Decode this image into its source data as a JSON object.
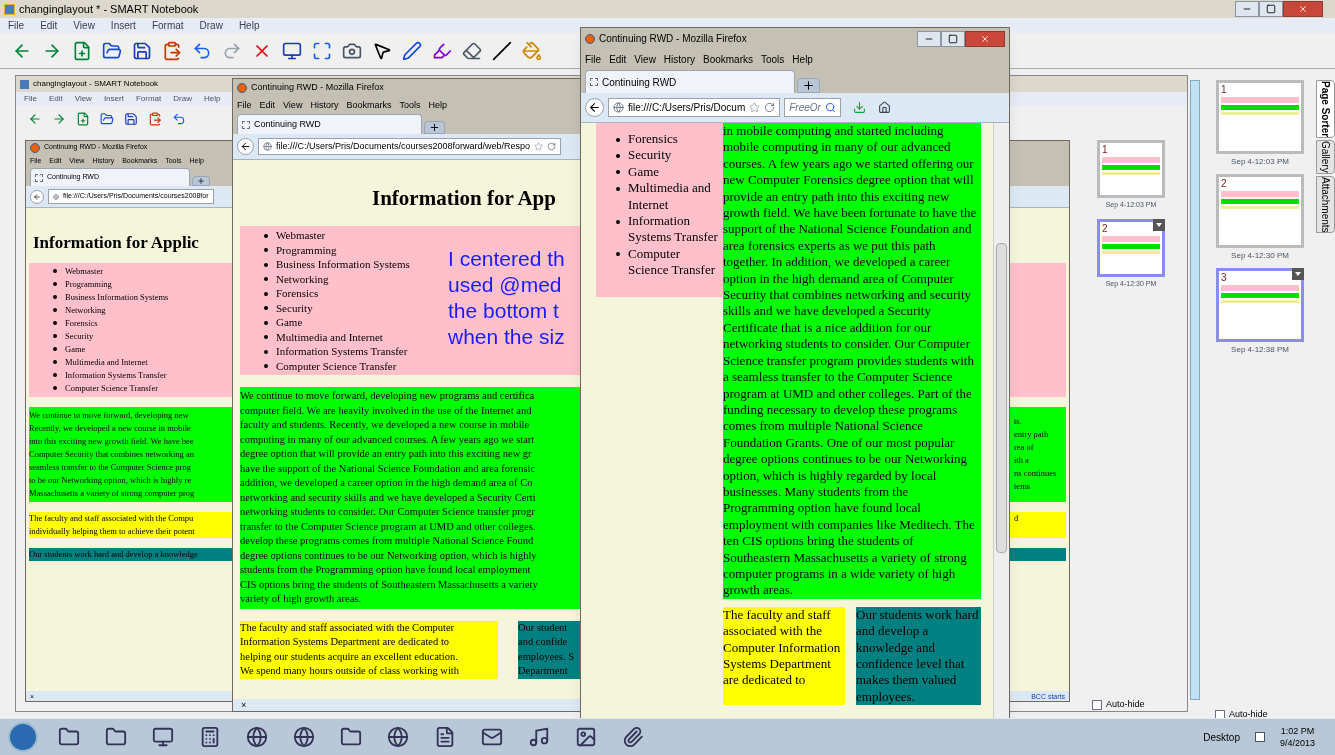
{
  "notebook": {
    "title": "changinglayout * - SMART Notebook",
    "menu": [
      "File",
      "Edit",
      "View",
      "Insert",
      "Format",
      "Draw",
      "Help"
    ]
  },
  "inner_notebook": {
    "title": "changinglayout - SMART Notebook",
    "menu": [
      "File",
      "Edit",
      "View",
      "Insert",
      "Format",
      "Draw",
      "Help"
    ],
    "sorter": {
      "pages": [
        {
          "number": "1",
          "time": "Sep 4-12:03 PM",
          "selected": false
        },
        {
          "number": "2",
          "time": "Sep 4-12:30 PM",
          "selected": true
        }
      ],
      "auto_hide": {
        "label": "Auto-hide",
        "checked": false
      }
    },
    "taskbar_item": "BCC starts"
  },
  "browsers": [
    {
      "kind": "back",
      "title": "Continuing RWD - Mozilla Firefox",
      "menu": [
        "File",
        "Edit",
        "View",
        "History",
        "Bookmarks",
        "Tools",
        "Help"
      ],
      "tab": "Continuing RWD",
      "url": "file:///C:/Users/Pris/Documents/courses2008for",
      "heading": "Information for Applic",
      "list": [
        "Webmaster",
        "Programming",
        "Business Information Systems",
        "Networking",
        "Forensics",
        "Security",
        "Game",
        "Multimedia and Internet",
        "Information Systems Transfer",
        "Computer Science Transfer"
      ],
      "green_lines": [
        "We continue to move forward, developing new",
        "Recently, we developed a new course in mobile",
        "into this exciting new growth field. We have bee",
        "Computer Security that combines networking an",
        "seamless transfer to the Computer Science prog",
        "to be our Networking option, which is highly re",
        "Massachusetts a variety of strong computer prog"
      ],
      "right_green_lines": [
        "ts.",
        "entry path",
        "rea of",
        "ith a",
        "ns continues",
        "tems"
      ],
      "yellow_lines": [
        "The faculty and staff associated with the Compu",
        "individually helping them to achieve their potent"
      ],
      "right_yellow_lines": [
        "d"
      ],
      "teal_lines": [
        "Our students work hard and develop a knowledge"
      ],
      "status": "×"
    },
    {
      "kind": "middle",
      "title": "Continuing RWD - Mozilla Firefox",
      "menu": [
        "File",
        "Edit",
        "View",
        "History",
        "Bookmarks",
        "Tools",
        "Help"
      ],
      "tab": "Continuing RWD",
      "url": "file:///C:/Users/Pris/Documents/courses2008forward/web/Respo",
      "heading": "Information for App",
      "list": [
        "Webmaster",
        "Programming",
        "Business Information Systems",
        "Networking",
        "Forensics",
        "Security",
        "Game",
        "Multimedia and Internet",
        "Information Systems Transfer",
        "Computer Science Transfer"
      ],
      "callout_lines": [
        "I centered th",
        "used @med",
        "the bottom t",
        "when the siz"
      ],
      "green_lines": [
        "We continue to move forward, developing new programs and certifica",
        "computer field. We are heavily involved in the use of the Internet and",
        "faculty and students. Recently, we developed a new course in mobile",
        "computing in many of our advanced courses. A few years ago we start",
        "degree option that will provide an entry path into this exciting new gr",
        "have the support of the National Science Foundation and area forensic",
        "addition, we developed a career option in the high demand area of Co",
        "networking and security skills and we have developed a Security Certi",
        "networking students to consider. Our Computer Science transfer progr",
        "transfer to the Computer Science program at UMD and other colleges.",
        "develop these programs comes from multiple National Science Found",
        "degree options continues to be our Networking option, which is highly",
        "students from the Programming option have found local employment",
        "CIS options bring the students of Southeastern Massachusetts a variety",
        "variety of high growth areas."
      ],
      "yellow_lines": [
        "The faculty and staff associated with the Computer",
        "Information Systems Department are dedicated to",
        "helping our students acquire an excellent education.",
        "We spend many hours outside of class working with"
      ],
      "teal_lines": [
        "Our student",
        "and confide",
        "employees. S",
        "Department"
      ],
      "status": "×"
    },
    {
      "kind": "front",
      "title": "Continuing RWD - Mozilla Firefox",
      "menu": [
        "File",
        "Edit",
        "View",
        "History",
        "Bookmarks",
        "Tools",
        "Help"
      ],
      "tab": "Continuing RWD",
      "url": "file:///C:/Users/Pris/Docum",
      "search": "FreeOr",
      "list": [
        "Forensics",
        "Security",
        "Game",
        "Multimedia and Internet",
        "Information Systems Transfer",
        "Computer Science Transfer"
      ],
      "green_text": "in mobile computing and started including mobile computing in many of our advanced courses. A few years ago we started offering our new Computer Forensics degree option that will provide an entry path into this exciting new growth field. We have been fortunate to have the support of the National Science Foundation and area forensics experts as we put this path together. In addition, we developed a career option in the high demand area of Computer Security that combines networking and security skills and we have developed a Security Certificate that is a nice addition for our networking students to consider. Our Computer Science transfer program provides students with a seamless transfer to the Computer Science program at UMD and other colleges. Part of the funding necessary to develop these programs comes from multiple National Science Foundation Grants. One of our most popular degree options continues to be our Networking option, which is highly regarded by local businesses. Many students from the Programming option have found local employment with companies like Meditech. The ten CIS options bring the students of Southeastern Massachusetts a variety of strong computer programs in a wide variety of high growth areas.",
      "yellow_text": "The faculty and staff associated with the Computer Information Systems Department are dedicated to",
      "teal_text": "Our students work hard and develop a knowledge and confidence level that makes them valued employees."
    }
  ],
  "page_sorter": {
    "pages": [
      {
        "number": "1",
        "time": "Sep 4-12:03 PM",
        "selected": false
      },
      {
        "number": "2",
        "time": "Sep 4-12:30 PM",
        "selected": false
      },
      {
        "number": "3",
        "time": "Sep 4-12:38 PM",
        "selected": true
      }
    ],
    "auto_hide": {
      "label": "Auto-hide",
      "checked": false
    },
    "tabs": [
      {
        "label": "Page Sorter",
        "selected": true
      },
      {
        "label": "Gallery",
        "selected": false
      },
      {
        "label": "Attachments",
        "selected": false
      }
    ]
  },
  "taskbar": {
    "desktop": "Desktop",
    "time": "1:02 PM",
    "date": "9/4/2013"
  }
}
